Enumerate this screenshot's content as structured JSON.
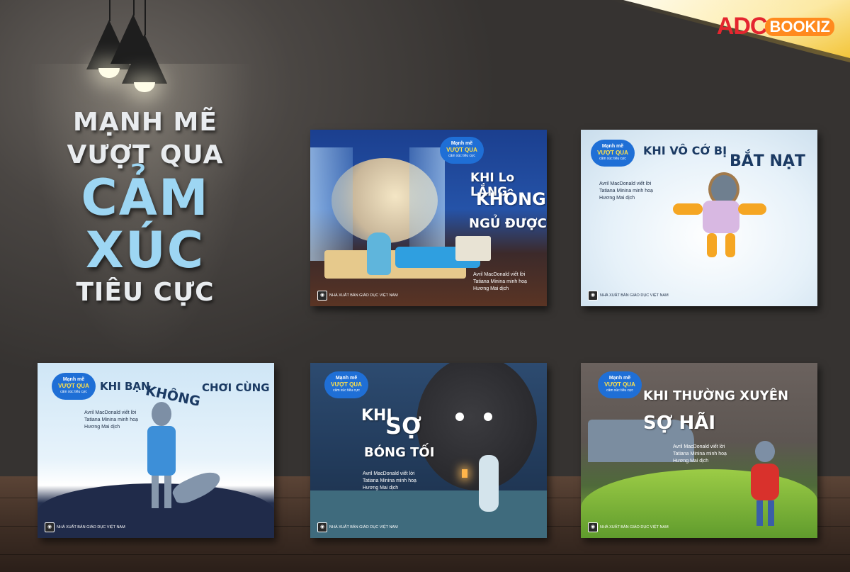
{
  "brand": {
    "part1": "ADC",
    "part2": "BOOKIZ"
  },
  "headline": {
    "line1": "MẠNH MẼ",
    "line2": "VƯỢT QUA",
    "line3": "CẢM",
    "line4": "XÚC",
    "line5": "TIÊU CỰC"
  },
  "books": [
    {
      "series_top": "Mạnh mẽ",
      "series_mid": "VƯỢT QUA",
      "series_bottom": "cảm xúc tiêu cực",
      "title_1": "KHI Lo LẮNG",
      "title_2": "KHÔNG",
      "title_3": "NGỦ ĐƯỢC",
      "author": "Avril MacDonald viết lời",
      "illustrator": "Tatiana Minina minh hoạ",
      "translator": "Hương Mai dịch",
      "publisher": "NHÀ XUẤT BẢN GIÁO DỤC VIỆT NAM"
    },
    {
      "series_top": "Mạnh mẽ",
      "series_mid": "VƯỢT QUA",
      "series_bottom": "cảm xúc tiêu cực",
      "title_1": "KHI VÔ CỚ BỊ",
      "title_2": "BẮT NẠT",
      "author": "Avril MacDonald viết lời",
      "illustrator": "Tatiana Minina minh hoạ",
      "translator": "Hương Mai dịch",
      "publisher": "NHÀ XUẤT BẢN GIÁO DỤC VIỆT NAM"
    },
    {
      "series_top": "Mạnh mẽ",
      "series_mid": "VƯỢT QUA",
      "series_bottom": "cảm xúc tiêu cực",
      "title_1": "KHI BẠN",
      "title_2": "KHÔNG",
      "title_3": "CHƠI CÙNG",
      "author": "Avril MacDonald viết lời",
      "illustrator": "Tatiana Minina minh hoạ",
      "translator": "Hương Mai dịch",
      "publisher": "NHÀ XUẤT BẢN GIÁO DỤC VIỆT NAM"
    },
    {
      "series_top": "Mạnh mẽ",
      "series_mid": "VƯỢT QUA",
      "series_bottom": "cảm xúc tiêu cực",
      "title_1": "KHI",
      "title_2": "SỢ",
      "title_3": "BÓNG TỐI",
      "author": "Avril MacDonald viết lời",
      "illustrator": "Tatiana Minina minh hoạ",
      "translator": "Hương Mai dịch",
      "publisher": "NHÀ XUẤT BẢN GIÁO DỤC VIỆT NAM"
    },
    {
      "series_top": "Mạnh mẽ",
      "series_mid": "VƯỢT QUA",
      "series_bottom": "cảm xúc tiêu cực",
      "title_1": "KHI THƯỜNG XUYÊN",
      "title_2": "SỢ HÃI",
      "author": "Avril MacDonald viết lời",
      "illustrator": "Tatiana Minina minh hoạ",
      "translator": "Hương Mai dịch",
      "publisher": "NHÀ XUẤT BẢN GIÁO DỤC VIỆT NAM"
    }
  ],
  "colors": {
    "headline_accent": "#9dd6f3",
    "brand_red": "#e4262f",
    "brand_orange": "#ff8a1e",
    "bubble_blue": "#1f6fd6"
  }
}
